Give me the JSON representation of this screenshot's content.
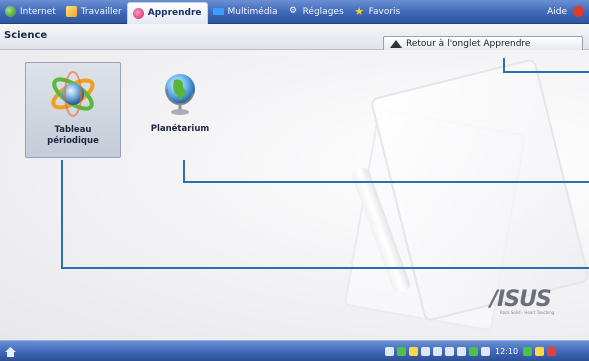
{
  "tabs": [
    {
      "label": "Internet",
      "icon": "globe-icon",
      "active": false
    },
    {
      "label": "Travailler",
      "icon": "briefcase-icon",
      "active": false
    },
    {
      "label": "Apprendre",
      "icon": "apple-icon",
      "active": true
    },
    {
      "label": "Multimédia",
      "icon": "film-icon",
      "active": false
    },
    {
      "label": "Réglages",
      "icon": "wrench-icon",
      "active": false
    },
    {
      "label": "Favoris",
      "icon": "star-icon",
      "active": false
    }
  ],
  "help": {
    "label": "Aide"
  },
  "section": {
    "title": "Science"
  },
  "back_button": {
    "label": "Retour à l'onglet Apprendre",
    "icon": "up-triangle-icon"
  },
  "apps": [
    {
      "line1": "Tableau",
      "line2": "périodique",
      "icon": "atom-icon",
      "selected": true
    },
    {
      "line1": "Planétarium",
      "line2": "",
      "icon": "globe-stand-icon",
      "selected": false
    }
  ],
  "branding": {
    "logo": "/ISUS",
    "tagline": "Rock Solid · Heart Touching"
  },
  "taskbar": {
    "clock": "12:10",
    "home_icon": "home-icon"
  },
  "colors": {
    "tab_bar": "#3f67b8",
    "callout": "#2b6fb3",
    "active_tab_text": "#17306a"
  }
}
